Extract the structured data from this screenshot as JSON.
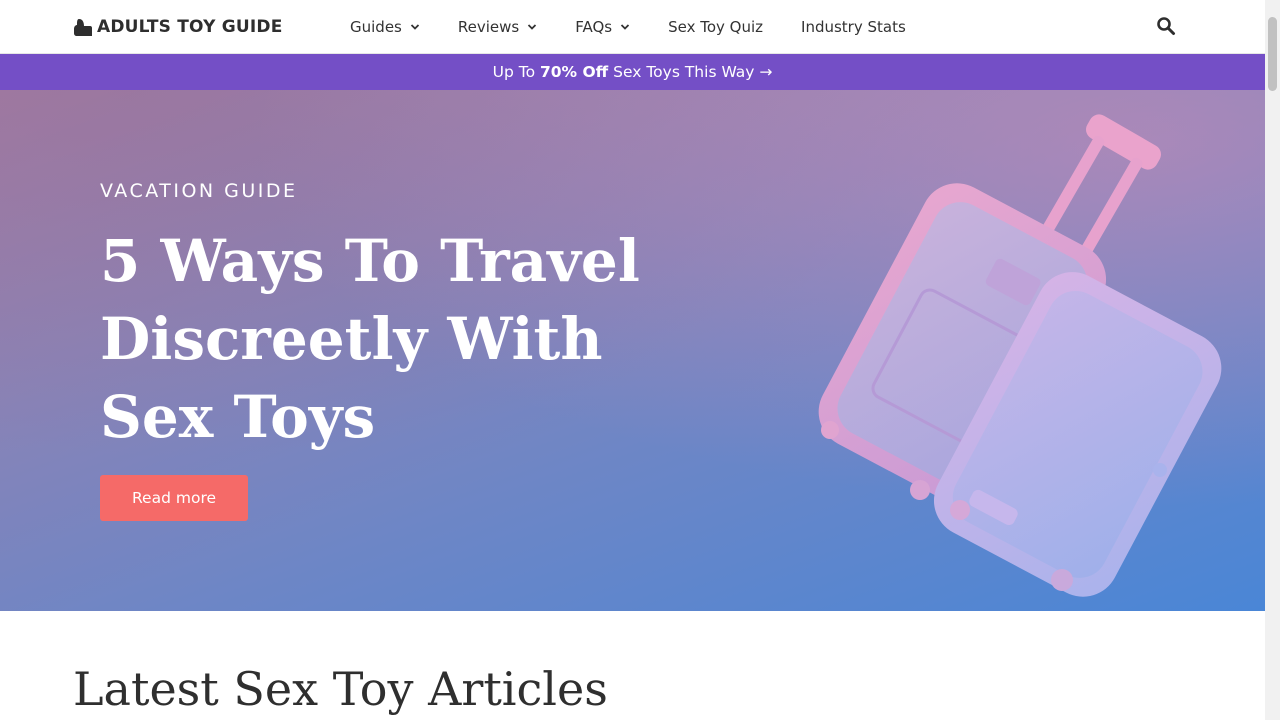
{
  "header": {
    "logo_text": "ADULTS TOY GUIDE",
    "nav": [
      {
        "label": "Guides",
        "has_dropdown": true
      },
      {
        "label": "Reviews",
        "has_dropdown": true
      },
      {
        "label": "FAQs",
        "has_dropdown": true
      },
      {
        "label": "Sex Toy Quiz",
        "has_dropdown": false
      },
      {
        "label": "Industry Stats",
        "has_dropdown": false
      }
    ],
    "search_icon": "search-icon"
  },
  "promo": {
    "prefix": "Up To ",
    "highlight": "70% Off",
    "suffix": " Sex Toys This Way →",
    "background": "#744fc6"
  },
  "hero": {
    "eyebrow": "VACATION GUIDE",
    "title": "5 Ways To Travel Discreetly With Sex Toys",
    "button_label": "Read more",
    "button_color": "#f56a68",
    "image": "pink-suitcase-illustration"
  },
  "latest": {
    "title": "Latest Sex Toy Articles"
  }
}
